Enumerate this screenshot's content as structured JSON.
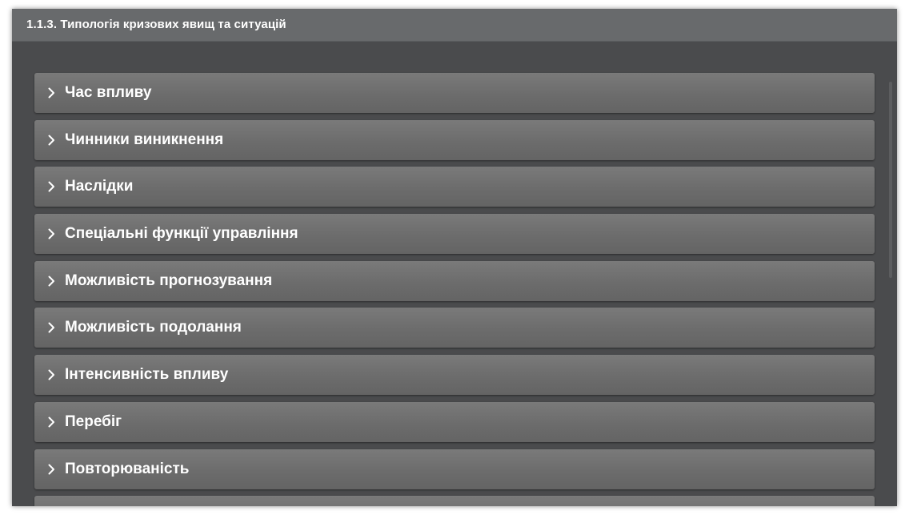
{
  "window": {
    "title": "1.1.3. Типологія кризових явищ та ситуацій"
  },
  "accordion": {
    "items": [
      {
        "label": "Час впливу",
        "icon": "chevron-right-icon"
      },
      {
        "label": "Чинники виникнення",
        "icon": "chevron-right-icon"
      },
      {
        "label": "Наслідки",
        "icon": "chevron-right-icon"
      },
      {
        "label": "Спеціальні функції управління",
        "icon": "chevron-right-icon"
      },
      {
        "label": "Можливість прогнозування",
        "icon": "chevron-right-icon"
      },
      {
        "label": "Можливість подолання",
        "icon": "chevron-right-icon"
      },
      {
        "label": "Інтенсивність впливу",
        "icon": "chevron-right-icon"
      },
      {
        "label": "Перебіг",
        "icon": "chevron-right-icon"
      },
      {
        "label": "Повторюваність",
        "icon": "chevron-right-icon"
      },
      {
        "label": "",
        "icon": "chevron-right-icon"
      }
    ]
  },
  "colors": {
    "titlebar": "#686a6c",
    "panel": "#4a4b4d",
    "item": "#6f6f6f",
    "text": "#ffffff"
  }
}
